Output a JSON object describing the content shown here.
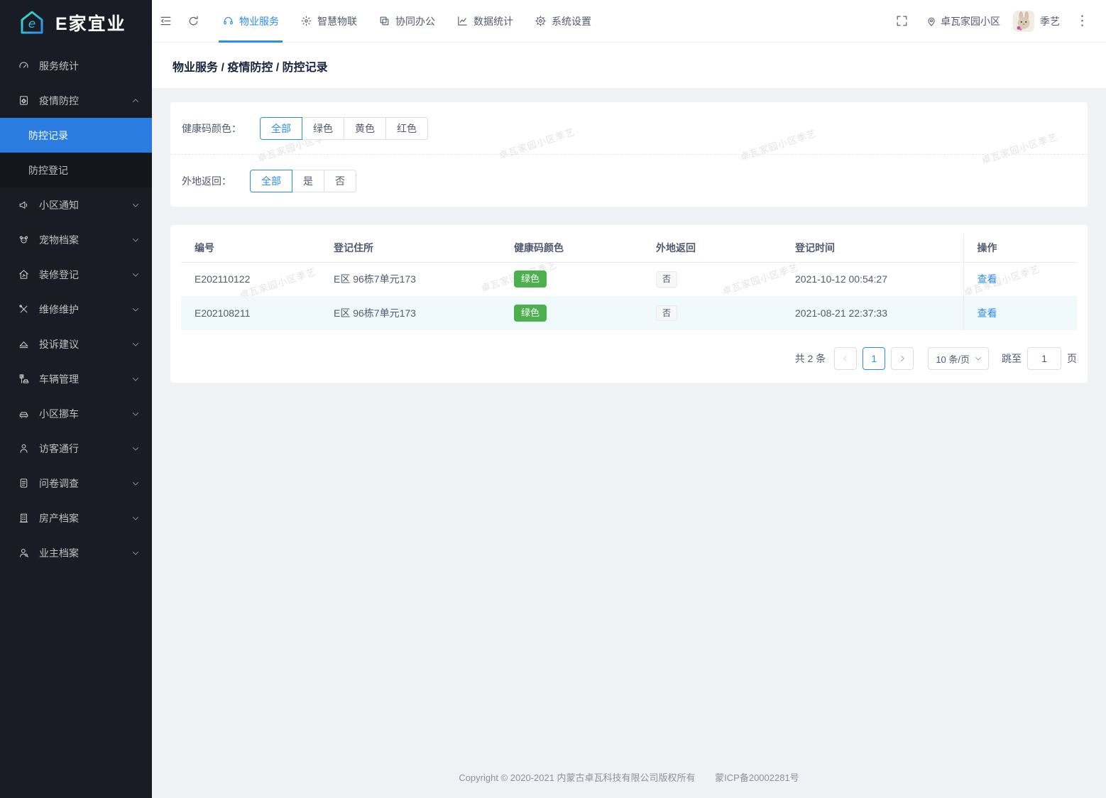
{
  "app": {
    "logo_text": "E家宜业"
  },
  "header": {
    "tabs": [
      {
        "label": "物业服务",
        "icon": "headset-icon",
        "active": true
      },
      {
        "label": "智慧物联",
        "icon": "iot-icon",
        "active": false
      },
      {
        "label": "协同办公",
        "icon": "office-icon",
        "active": false
      },
      {
        "label": "数据统计",
        "icon": "chart-icon",
        "active": false
      },
      {
        "label": "系统设置",
        "icon": "gear-icon",
        "active": false
      }
    ],
    "community": "卓瓦家园小区",
    "username": "季艺"
  },
  "sidebar": {
    "items": [
      {
        "label": "服务统计",
        "icon": "gauge-icon",
        "has_children": false
      },
      {
        "label": "疫情防控",
        "icon": "epidemic-icon",
        "has_children": true,
        "expanded": true,
        "children": [
          {
            "label": "防控记录",
            "active": true
          },
          {
            "label": "防控登记",
            "active": false
          }
        ]
      },
      {
        "label": "小区通知",
        "icon": "megaphone-icon",
        "has_children": true,
        "expanded": false
      },
      {
        "label": "宠物档案",
        "icon": "pet-icon",
        "has_children": true,
        "expanded": false
      },
      {
        "label": "装修登记",
        "icon": "renovation-icon",
        "has_children": true,
        "expanded": false
      },
      {
        "label": "维修维护",
        "icon": "repair-icon",
        "has_children": true,
        "expanded": false
      },
      {
        "label": "投诉建议",
        "icon": "complaint-icon",
        "has_children": true,
        "expanded": false
      },
      {
        "label": "车辆管理",
        "icon": "vehicle-icon",
        "has_children": true,
        "expanded": false
      },
      {
        "label": "小区挪车",
        "icon": "move-car-icon",
        "has_children": true,
        "expanded": false
      },
      {
        "label": "访客通行",
        "icon": "visitor-icon",
        "has_children": true,
        "expanded": false
      },
      {
        "label": "问卷调查",
        "icon": "survey-icon",
        "has_children": true,
        "expanded": false
      },
      {
        "label": "房产档案",
        "icon": "property-icon",
        "has_children": true,
        "expanded": false
      },
      {
        "label": "业主档案",
        "icon": "owner-icon",
        "has_children": true,
        "expanded": false
      }
    ]
  },
  "breadcrumb": "物业服务 / 疫情防控 / 防控记录",
  "filters": {
    "health_code_label": "健康码颜色：",
    "health_code_options": [
      "全部",
      "绿色",
      "黄色",
      "红色"
    ],
    "health_code_selected": "全部",
    "return_label": "外地返回：",
    "return_options": [
      "全部",
      "是",
      "否"
    ],
    "return_selected": "全部"
  },
  "table": {
    "columns": [
      "编号",
      "登记住所",
      "健康码颜色",
      "外地返回",
      "登记时间",
      "操作"
    ],
    "rows": [
      {
        "id": "E202110122",
        "address": "E区 96栋7单元173",
        "health_code": "绿色",
        "returned": "否",
        "time": "2021-10-12 00:54:27",
        "action": "查看"
      },
      {
        "id": "E202108211",
        "address": "E区 96栋7单元173",
        "health_code": "绿色",
        "returned": "否",
        "time": "2021-08-21 22:37:33",
        "action": "查看"
      }
    ]
  },
  "pagination": {
    "total_text": "共 2 条",
    "current_page": "1",
    "page_size": "10 条/页",
    "jump_label": "跳至",
    "jump_value": "1",
    "page_suffix": "页"
  },
  "watermark": {
    "text": "卓瓦家园小区季艺"
  },
  "footer": {
    "copyright": "Copyright © 2020-2021 内蒙古卓瓦科技有限公司版权所有",
    "icp": "蒙ICP备20002281号"
  },
  "colors": {
    "primary": "#2d8cf0",
    "sidebar_active": "#2b7ce0",
    "success_badge": "#4cb04f"
  }
}
